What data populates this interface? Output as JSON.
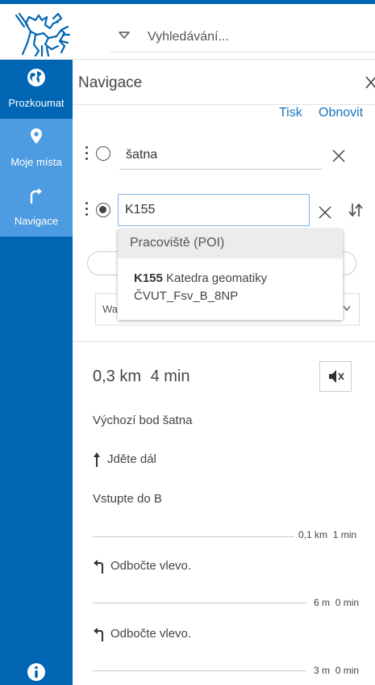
{
  "search": {
    "placeholder": "Vyhledávání..."
  },
  "sidebar": {
    "items": [
      {
        "label": "Prozkoumat",
        "icon": "globe-icon"
      },
      {
        "label": "Moje místa",
        "icon": "map-pin-icon"
      },
      {
        "label": "Navigace",
        "icon": "turn-arrow-icon"
      }
    ],
    "footer_icon": "info-icon"
  },
  "panel": {
    "title": "Navigace",
    "print_label": "Tisk",
    "refresh_label": "Obnovit"
  },
  "stops": [
    {
      "value": "šatna"
    },
    {
      "value": "K155"
    }
  ],
  "mode_select": {
    "value": "Wa"
  },
  "suggestions": {
    "header": "Pracoviště (POI)",
    "item": {
      "code": "K155",
      "name": "Katedra geomatiky",
      "location": "ČVUT_Fsv_B_8NP"
    }
  },
  "route": {
    "distance": "0,3 km",
    "time": "4 min",
    "steps": [
      {
        "text": "Výchozí bod šatna",
        "icon": ""
      },
      {
        "text": "Jděte dál",
        "icon": "arrow-up-icon"
      },
      {
        "text": "Vstupte do B",
        "icon": "",
        "distance": "0,1 km",
        "time": "1 min"
      },
      {
        "text": "Odbočte vlevo.",
        "icon": "turn-left-icon",
        "distance": "6 m",
        "time": "0 min"
      },
      {
        "text": "Odbočte vlevo.",
        "icon": "turn-left-icon",
        "distance": "3 m",
        "time": "0 min"
      }
    ]
  },
  "colors": {
    "brand": "#0066b3",
    "active": "#4d9be0",
    "link": "#1a73c0"
  }
}
